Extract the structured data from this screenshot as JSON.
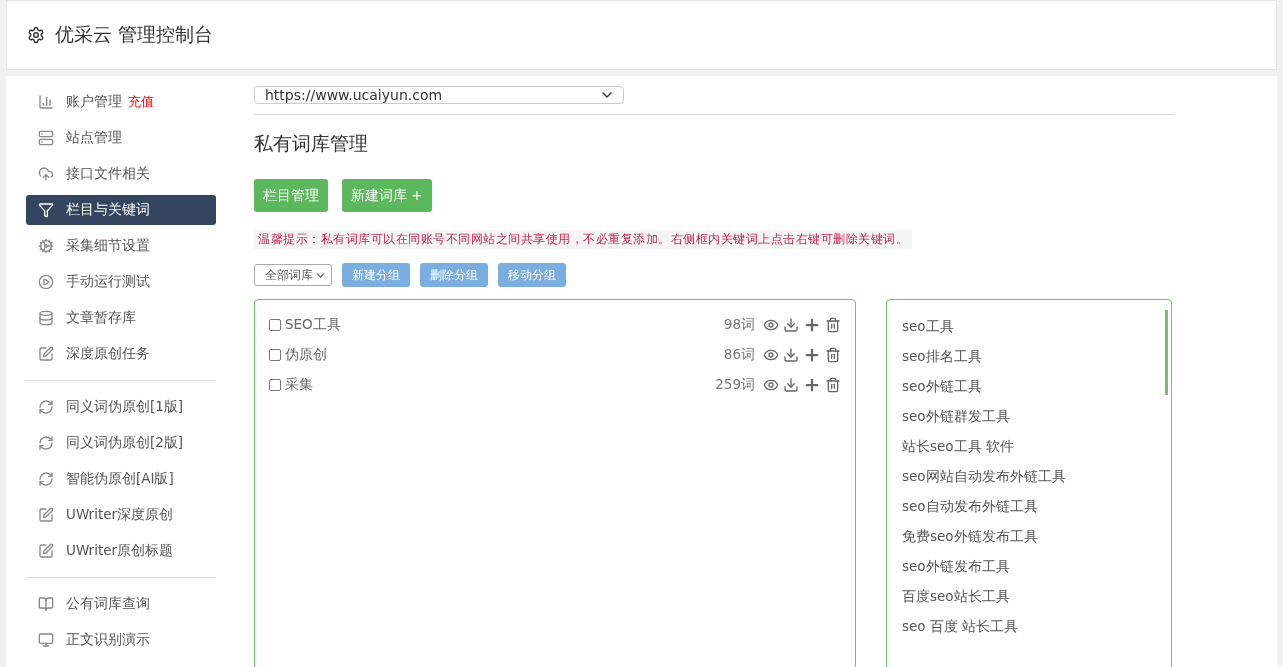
{
  "header": {
    "title": "优采云 管理控制台"
  },
  "sidebar": {
    "groups": [
      [
        {
          "label": "账户管理",
          "badge": "充值",
          "selected": false
        },
        {
          "label": "站点管理",
          "selected": false
        },
        {
          "label": "接口文件相关",
          "selected": false
        },
        {
          "label": "栏目与关键词",
          "selected": true
        },
        {
          "label": "采集细节设置",
          "selected": false
        },
        {
          "label": "手动运行测试",
          "selected": false
        },
        {
          "label": "文章暂存库",
          "selected": false
        },
        {
          "label": "深度原创任务",
          "selected": false
        }
      ],
      [
        {
          "label": "同义词伪原创[1版]",
          "selected": false
        },
        {
          "label": "同义词伪原创[2版]",
          "selected": false
        },
        {
          "label": "智能伪原创[AI版]",
          "selected": false
        },
        {
          "label": "UWriter深度原创",
          "selected": false
        },
        {
          "label": "UWriter原创标题",
          "selected": false
        }
      ],
      [
        {
          "label": "公有词库查询",
          "selected": false
        },
        {
          "label": "正文识别演示",
          "selected": false
        }
      ]
    ]
  },
  "site_select": {
    "value": "https://www.ucaiyun.com"
  },
  "page_title": "私有词库管理",
  "action_buttons": [
    "栏目管理",
    "新建词库 +"
  ],
  "tip": "温馨提示：私有词库可以在同账号不同网站之间共享使用，不必重复添加。右侧框内关键词上点击右键可删除关键词。",
  "filter": {
    "value": "全部词库"
  },
  "group_buttons": [
    "新建分组",
    "删除分组",
    "移动分组"
  ],
  "libraries": [
    {
      "name": "SEO工具",
      "count": "98词",
      "checked": false
    },
    {
      "name": "伪原创",
      "count": "86词",
      "checked": false
    },
    {
      "name": "采集",
      "count": "259词",
      "checked": false
    }
  ],
  "keywords": [
    "seo工具",
    "seo排名工具",
    "seo外链工具",
    "seo外链群发工具",
    "站长seo工具 软件",
    "seo网站自动发布外链工具",
    "seo自动发布外链工具",
    "免费seo外链发布工具",
    "seo外链发布工具",
    "百度seo站长工具",
    "seo 百度 站长工具"
  ]
}
